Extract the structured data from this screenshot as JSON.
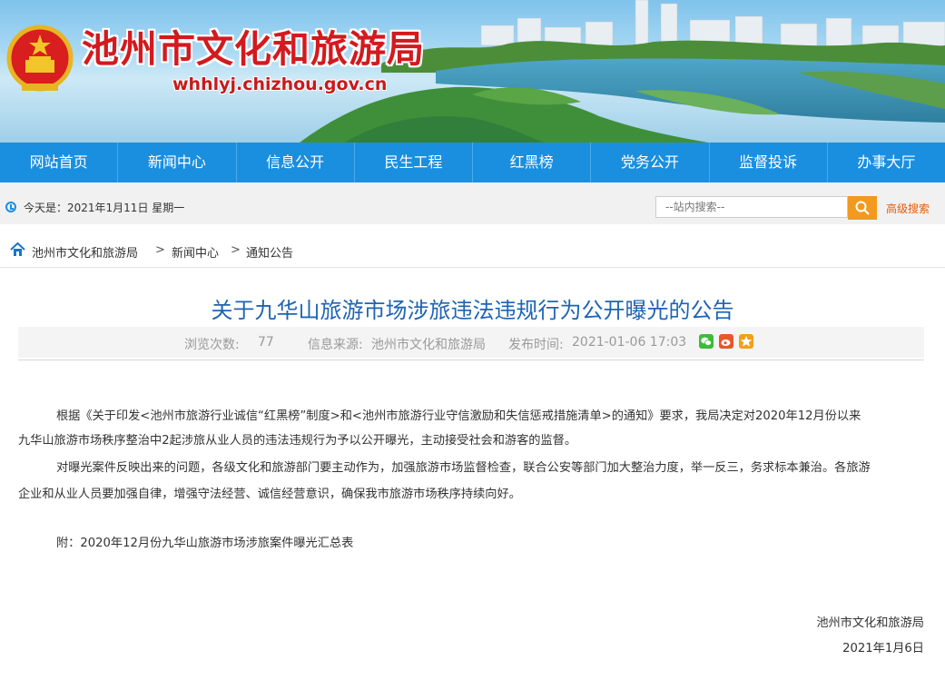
{
  "header": {
    "site_title": "池州市文化和旅游局",
    "site_url": "whhlyj.chizhou.gov.cn"
  },
  "nav": {
    "items": [
      "网站首页",
      "新闻中心",
      "信息公开",
      "民生工程",
      "红黑榜",
      "党务公开",
      "监督投诉",
      "办事大厅"
    ]
  },
  "infobar": {
    "date": "今天是：2021年1月11日 星期一",
    "search_placeholder": "--站内搜索--",
    "advanced_search": "高级搜索"
  },
  "breadcrumb": {
    "items": [
      "池州市文化和旅游局",
      "新闻中心",
      "通知公告"
    ],
    "separator": ">"
  },
  "article": {
    "title": "关于九华山旅游市场涉旅违法违规行为公开曝光的公告",
    "views_label": "浏览次数:",
    "views": "77",
    "source_label": "信息来源:",
    "source": "池州市文化和旅游局",
    "time_label": "发布时间:",
    "time": "2021-01-06 17:03",
    "share_icons": [
      "wechat-icon",
      "weibo-icon",
      "favorite-icon"
    ],
    "paragraphs": [
      "根据《关于印发<池州市旅游行业诚信“红黑榜”制度>和<池州市旅游行业守信激励和失信惩戒措施清单>的通知》要求，我局决定对2020年12月份以来",
      "九华山旅游市场秩序整治中2起涉旅从业人员的违法违规行为予以公开曝光，主动接受社会和游客的监督。",
      "对曝光案件反映出来的问题，各级文化和旅游部门要主动作为，加强旅游市场监督检查，联合公安等部门加大整治力度，举一反三，务求标本兼治。各旅游",
      "企业和从业人员要加强自律，增强守法经营、诚信经营意识，确保我市旅游市场秩序持续向好。",
      "附：2020年12月份九华山旅游市场涉旅案件曝光汇总表"
    ],
    "signature": "池州市文化和旅游局",
    "sign_date": "2021年1月6日"
  },
  "colors": {
    "nav_bg": "#1a8fe0",
    "title_blue": "#1e64b4",
    "site_title_red": "#d21a1f",
    "search_orange": "#f19a1f"
  }
}
